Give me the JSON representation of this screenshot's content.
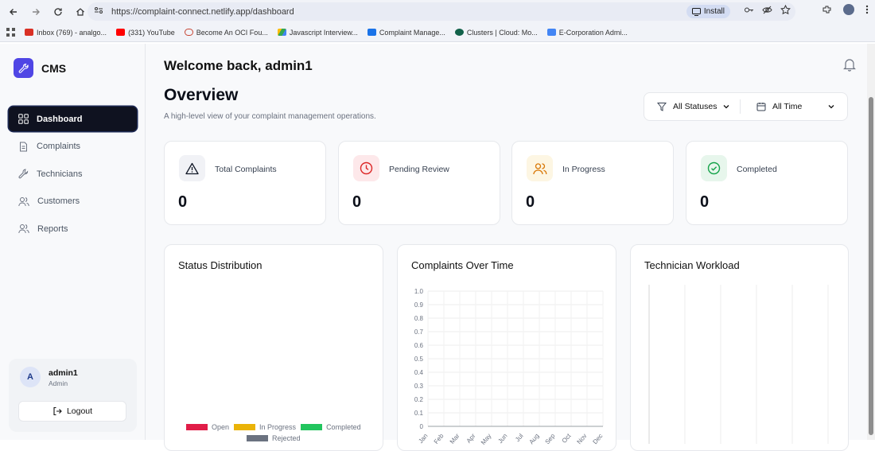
{
  "browser": {
    "url": "https://complaint-connect.netlify.app/dashboard",
    "install_label": "Install",
    "bookmarks": [
      {
        "label": "Inbox (769) - analgo...",
        "color": "#d93025"
      },
      {
        "label": "(331) YouTube",
        "color": "#ff0000"
      },
      {
        "label": "Become An OCI Fou...",
        "color": "#c74634"
      },
      {
        "label": "Javascript Interview...",
        "color": "#34a853"
      },
      {
        "label": "Complaint Manage...",
        "color": "#1a73e8"
      },
      {
        "label": "Clusters | Cloud: Mo...",
        "color": "#116149"
      },
      {
        "label": "E-Corporation Admi...",
        "color": "#4285f4"
      }
    ]
  },
  "sidebar": {
    "brand": "CMS",
    "items": [
      {
        "label": "Dashboard",
        "icon": "grid-icon",
        "active": true
      },
      {
        "label": "Complaints",
        "icon": "document-icon"
      },
      {
        "label": "Technicians",
        "icon": "wrench-icon"
      },
      {
        "label": "Customers",
        "icon": "users-icon"
      },
      {
        "label": "Reports",
        "icon": "users-icon"
      }
    ],
    "user": {
      "initial": "A",
      "name": "admin1",
      "role": "Admin",
      "logout_label": "Logout"
    }
  },
  "header": {
    "welcome": "Welcome back, admin1",
    "title": "Overview",
    "subtitle": "A high-level view of your complaint management operations."
  },
  "filters": {
    "status": "All Statuses",
    "time": "All Time"
  },
  "stats": [
    {
      "label": "Total Complaints",
      "value": "0",
      "icon": "alert-triangle-icon",
      "color": "#111827",
      "bg": "#f1f2f6"
    },
    {
      "label": "Pending Review",
      "value": "0",
      "icon": "clock-icon",
      "color": "#dc2626",
      "bg": "#fde8ea"
    },
    {
      "label": "In Progress",
      "value": "0",
      "icon": "users-icon",
      "color": "#d97706",
      "bg": "#fdf6e3"
    },
    {
      "label": "Completed",
      "value": "0",
      "icon": "check-circle-icon",
      "color": "#16a34a",
      "bg": "#e7f6ec"
    }
  ],
  "charts": {
    "status_title": "Status Distribution",
    "time_title": "Complaints Over Time",
    "workload_title": "Technician Workload"
  },
  "chart_data": [
    {
      "type": "pie",
      "title": "Status Distribution",
      "categories": [
        "Open",
        "In Progress",
        "Completed",
        "Rejected"
      ],
      "values": [
        0,
        0,
        0,
        0
      ],
      "colors": [
        "#e11d48",
        "#eab308",
        "#22c55e",
        "#6b7280"
      ],
      "legend": "bottom"
    },
    {
      "type": "line",
      "title": "Complaints Over Time",
      "categories": [
        "Jan",
        "Feb",
        "Mar",
        "Apr",
        "May",
        "Jun",
        "Jul",
        "Aug",
        "Sep",
        "Oct",
        "Nov",
        "Dec"
      ],
      "values": [
        0,
        0,
        0,
        0,
        0,
        0,
        0,
        0,
        0,
        0,
        0,
        0
      ],
      "ylim": [
        0,
        1
      ],
      "yticks": [
        "0",
        "0.1",
        "0.2",
        "0.3",
        "0.4",
        "0.5",
        "0.6",
        "0.7",
        "0.8",
        "0.9",
        "1.0"
      ],
      "grid": true
    },
    {
      "type": "bar",
      "title": "Technician Workload",
      "categories": [],
      "values": [],
      "grid": true
    }
  ]
}
